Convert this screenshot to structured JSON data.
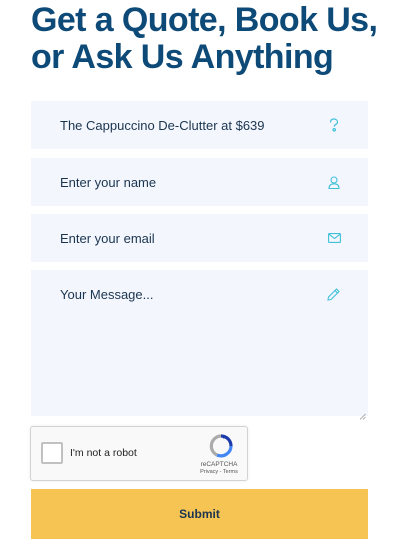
{
  "heading": "Get a Quote, Book Us, or Ask Us Anything",
  "form": {
    "package_field": {
      "value": "The Cappuccino De-Clutter at $639",
      "icon": "question-icon"
    },
    "name_field": {
      "placeholder": "Enter your name",
      "icon": "user-icon"
    },
    "email_field": {
      "placeholder": "Enter your email",
      "icon": "envelope-icon"
    },
    "message_field": {
      "placeholder": "Your Message...",
      "icon": "pencil-icon"
    },
    "submit_label": "Submit"
  },
  "captcha": {
    "label": "I'm not a robot",
    "brand": "reCAPTCHA",
    "links": "Privacy - Terms",
    "checked": false
  },
  "colors": {
    "heading": "#0d4a78",
    "field_bg": "#f4f6fd",
    "icon": "#3ec0d8",
    "submit_bg": "#f6c453"
  }
}
